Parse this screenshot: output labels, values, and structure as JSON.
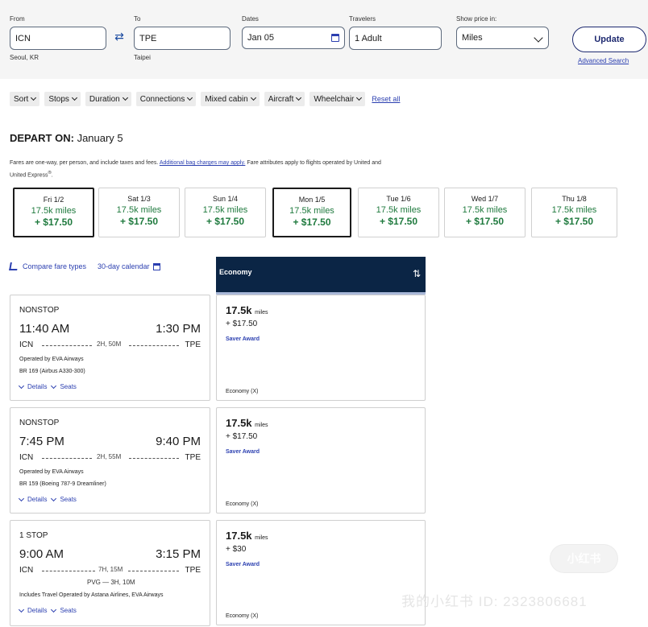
{
  "search": {
    "from_label": "From",
    "from_value": "ICN",
    "from_sub": "Seoul, KR",
    "to_label": "To",
    "to_value": "TPE",
    "to_sub": "Taipei",
    "dates_label": "Dates",
    "dates_value": "Jan 05",
    "travelers_label": "Travelers",
    "travelers_value": "1 Adult",
    "price_label": "Show price in:",
    "price_value": "Miles",
    "update_label": "Update",
    "advanced_label": "Advanced Search"
  },
  "filters": {
    "chips": [
      "Sort",
      "Stops",
      "Duration",
      "Connections",
      "Mixed cabin",
      "Aircraft",
      "Wheelchair"
    ],
    "reset_label": "Reset all"
  },
  "depart": {
    "title_prefix": "DEPART ON:",
    "title_date": "January 5",
    "note_1": "Fares are one-way, per person, and include taxes and fees.",
    "note_link": "Additional bag charges may apply.",
    "note_2": "Fare attributes apply to flights operated by United and United Express",
    "note_sup": "®",
    "note_end": "."
  },
  "date_tabs": [
    {
      "day": "Fri 1/2",
      "miles": "17.5k miles",
      "price": "+ $17.50",
      "selected": true
    },
    {
      "day": "Sat 1/3",
      "miles": "17.5k miles",
      "price": "+ $17.50",
      "selected": false
    },
    {
      "day": "Sun 1/4",
      "miles": "17.5k miles",
      "price": "+ $17.50",
      "selected": false
    },
    {
      "day": "Mon 1/5",
      "miles": "17.5k miles",
      "price": "+ $17.50",
      "selected": true
    },
    {
      "day": "Tue 1/6",
      "miles": "17.5k miles",
      "price": "+ $17.50",
      "selected": false
    },
    {
      "day": "Wed 1/7",
      "miles": "17.5k miles",
      "price": "+ $17.50",
      "selected": false
    },
    {
      "day": "Thu 1/8",
      "miles": "17.5k miles",
      "price": "+ $17.50",
      "selected": false
    }
  ],
  "links": {
    "compare_label": "Compare fare types",
    "calendar_label": "30-day calendar"
  },
  "economy_header": "Economy",
  "flights": [
    {
      "stops": "NONSTOP",
      "dep_time": "11:40 AM",
      "arr_time": "1:30 PM",
      "dep_code": "ICN",
      "arr_code": "TPE",
      "duration": "2H, 50M",
      "layover": "",
      "operated": "Operated by EVA Airways",
      "flight_info": "BR 169 (Airbus A330-300)",
      "details_label": "Details",
      "seats_label": "Seats",
      "fare_miles": "17.5k",
      "fare_miles_unit": "miles",
      "fare_tax": "+ $17.50",
      "fare_type": "Saver Award",
      "cabin": "Economy (X)"
    },
    {
      "stops": "NONSTOP",
      "dep_time": "7:45 PM",
      "arr_time": "9:40 PM",
      "dep_code": "ICN",
      "arr_code": "TPE",
      "duration": "2H, 55M",
      "layover": "",
      "operated": "Operated by EVA Airways",
      "flight_info": "BR 159 (Boeing 787-9 Dreamliner)",
      "details_label": "Details",
      "seats_label": "Seats",
      "fare_miles": "17.5k",
      "fare_miles_unit": "miles",
      "fare_tax": "+ $17.50",
      "fare_type": "Saver Award",
      "cabin": "Economy (X)"
    },
    {
      "stops": "1 STOP",
      "dep_time": "9:00 AM",
      "arr_time": "3:15 PM",
      "dep_code": "ICN",
      "arr_code": "TPE",
      "duration": "7H, 15M",
      "layover": "PVG — 3H, 10M",
      "operated": "Includes Travel Operated by Astana Airlines, EVA Airways",
      "flight_info": "",
      "details_label": "Details",
      "seats_label": "Seats",
      "fare_miles": "17.5k",
      "fare_miles_unit": "miles",
      "fare_tax": "+ $30",
      "fare_type": "Saver Award",
      "cabin": "Economy (X)"
    }
  ],
  "watermark": {
    "badge": "小红书",
    "text": "我的小红书 ID: 2323806681"
  }
}
